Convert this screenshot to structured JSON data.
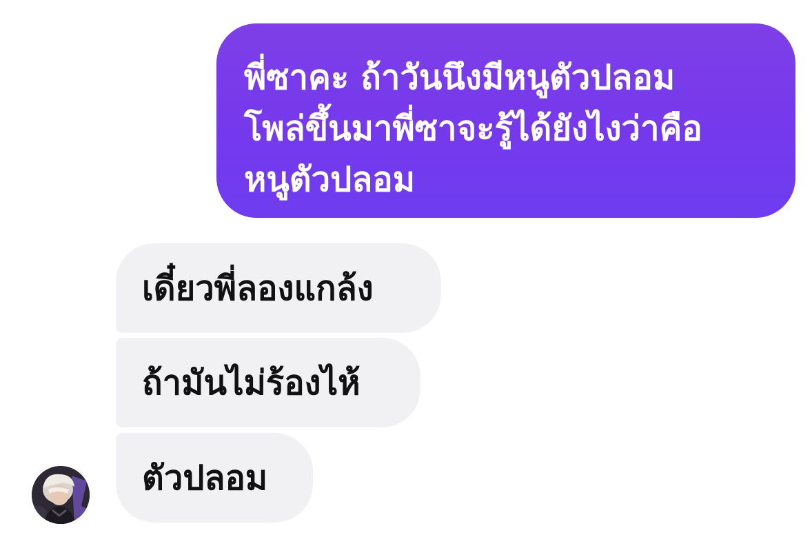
{
  "conversation": {
    "sent_message": "พี่ซาคะ ถ้าวันนึงมีหนูตัวปลอม\nโพล่ขึ้นมาพี่ซาจะรู้ได้ยังไงว่าคือ\nหนูตัวปลอม",
    "received_messages": [
      "เดี๋ยวพี่ลองแกล้ง",
      "ถ้ามันไม่ร้องไห้",
      "ตัวปลอม"
    ]
  },
  "colors": {
    "sent_bubble": "#7539ec",
    "received_bubble": "#f1f1f4",
    "sent_text": "#ffffff",
    "received_text": "#111111"
  },
  "icons": {
    "avatar": "contact-avatar"
  }
}
